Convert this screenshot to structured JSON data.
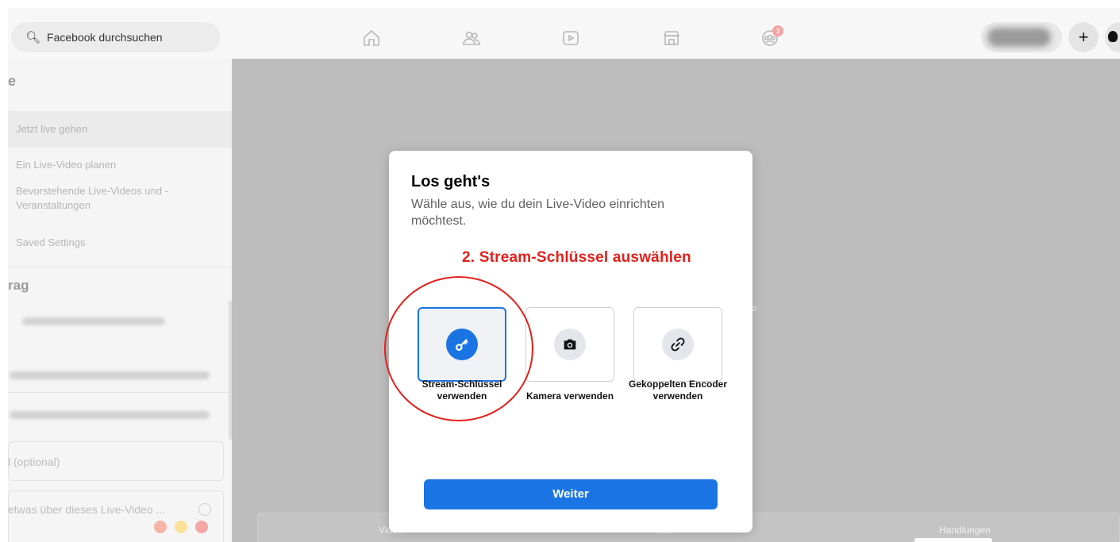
{
  "search": {
    "placeholder": "Facebook durchsuchen"
  },
  "topnav": {
    "icons": [
      "home-icon",
      "friends-icon",
      "watch-icon",
      "marketplace-icon",
      "groups-icon"
    ],
    "groups_badge": "3",
    "plus_label": "+"
  },
  "sidebar": {
    "header_letter": "e",
    "items": [
      {
        "label": "Jetzt live gehen"
      },
      {
        "label": "Ein Live-Video planen"
      },
      {
        "label": "Bevorstehende Live-Videos und -Veranstaltungen"
      },
      {
        "label": "Saved Settings"
      }
    ],
    "section_title": "rag",
    "field_placeholder": "l (optional)",
    "description_placeholder": "etwas über dieses Live-Video ..."
  },
  "background": {
    "bottom_tabs": [
      "Video",
      "Titel",
      "Handlungen"
    ]
  },
  "modal": {
    "title": "Los geht's",
    "subtitle": "Wähle aus, wie du dein Live-Video einrichten möchtest.",
    "annotation": "2. Stream-Schlüssel auswählen",
    "options": [
      {
        "label": "Stream-Schlüssel verwenden",
        "icon": "key-icon",
        "selected": true
      },
      {
        "label": "Kamera verwenden",
        "icon": "camera-icon",
        "selected": false
      },
      {
        "label": "Gekoppelten Encoder verwenden",
        "icon": "link-icon",
        "selected": false
      }
    ],
    "continue_label": "Weiter"
  },
  "colors": {
    "accent": "#1b74e4",
    "annotation": "#e3201b"
  }
}
